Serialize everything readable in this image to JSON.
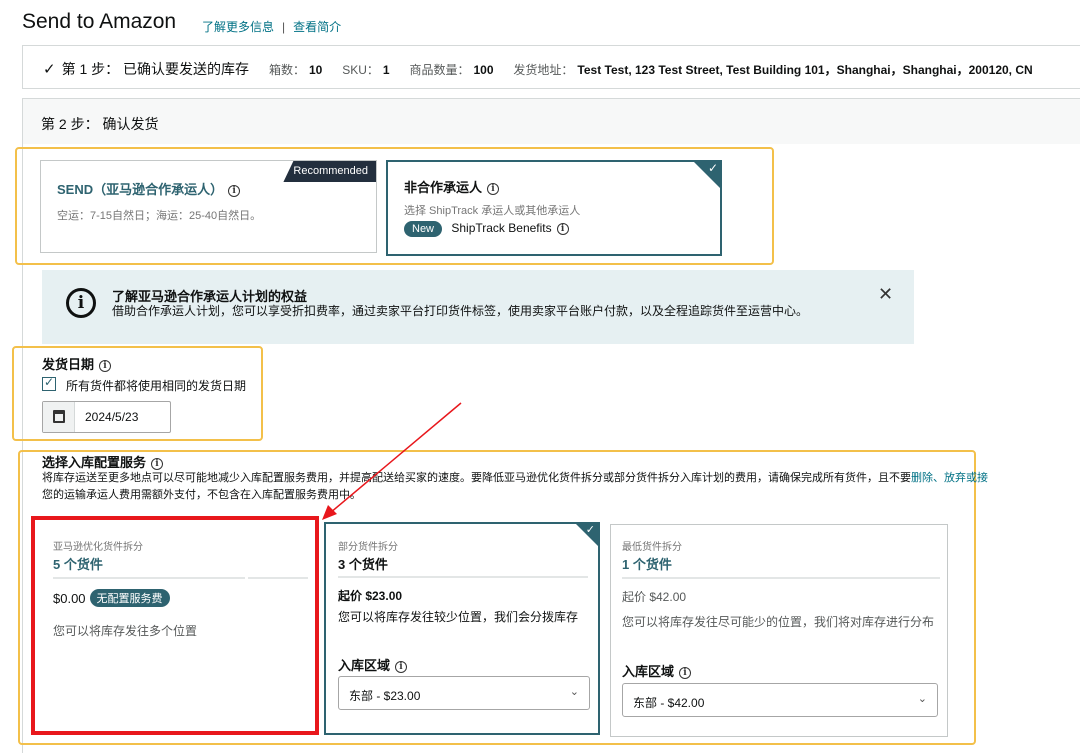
{
  "header": {
    "title": "Send to Amazon",
    "link_learn_more": "了解更多信息",
    "link_intro": "查看简介"
  },
  "step1": {
    "check_glyph": "✓",
    "title": "第 1 步： 已确认要发送的库存",
    "boxes_label": "箱数：",
    "boxes_value": "10",
    "sku_label": "SKU：",
    "sku_value": "1",
    "qty_label": "商品数量：",
    "qty_value": "100",
    "address_label": "发货地址：",
    "address_value": "Test Test, 123 Test Street, Test Building 101，Shanghai，Shanghai，200120, CN"
  },
  "step2": {
    "title": "第 2 步： 确认发货"
  },
  "carriers": {
    "send": {
      "title": "SEND（亚马逊合作承运人）",
      "badge": "Recommended",
      "sub": "空运：7-15自然日；海运：25-40自然日。"
    },
    "non_partner": {
      "title": "非合作承运人",
      "sub": "选择 ShipTrack 承运人或其他承运人",
      "new_badge": "New",
      "benefits_link": "ShipTrack Benefits",
      "check_glyph": "✓"
    }
  },
  "banner": {
    "icon_glyph": "i",
    "title": "了解亚马逊合作承运人计划的权益",
    "text": "借助合作承运人计划，您可以享受折扣费率，通过卖家平台打印货件标签，使用卖家平台账户付款，以及全程追踪货件至运营中心。",
    "close_glyph": "✕"
  },
  "ship_date": {
    "label": "发货日期",
    "checkbox_label": "所有货件都将使用相同的发货日期",
    "checkbox_tick": "✓",
    "date_value": "2024/5/23"
  },
  "placement": {
    "label": "选择入库配置服务",
    "desc_part1": "将库存运送至更多地点可以尽可能地减少入库配置服务费用，并提高配送给买家的速度。要降低亚马逊优化货件拆分或部分货件拆分入库计划的费用，请确保完成所有货件，且不要",
    "desc_link": "删除、放弃或接",
    "desc_part2": "您的运输承运人费用需额外支付，不包含在入库配置服务费用中。",
    "options": [
      {
        "small": "亚马逊优化货件拆分",
        "count": "5 个货件",
        "price": "$0.00",
        "free_badge": "无配置服务费",
        "desc": "您可以将库存发往多个位置"
      },
      {
        "small": "部分货件拆分",
        "count": "3 个货件",
        "price": "起价 $23.00",
        "desc": "您可以将库存发往较少位置，我们会分拨库存",
        "region_label": "入库区域",
        "region_value": "东部 - $23.00",
        "check_glyph": "✓"
      },
      {
        "small": "最低货件拆分",
        "count": "1 个货件",
        "price": "起价 $42.00",
        "desc": "您可以将库存发往尽可能少的位置，我们将对库存进行分布",
        "region_label": "入库区域",
        "region_value": "东部 - $42.00"
      }
    ],
    "chevron_glyph": "⌄"
  },
  "colors": {
    "teal": "#2e6370",
    "link": "#007185",
    "highlight_yellow": "#f3c04a",
    "annotation_red": "#e8171c"
  }
}
